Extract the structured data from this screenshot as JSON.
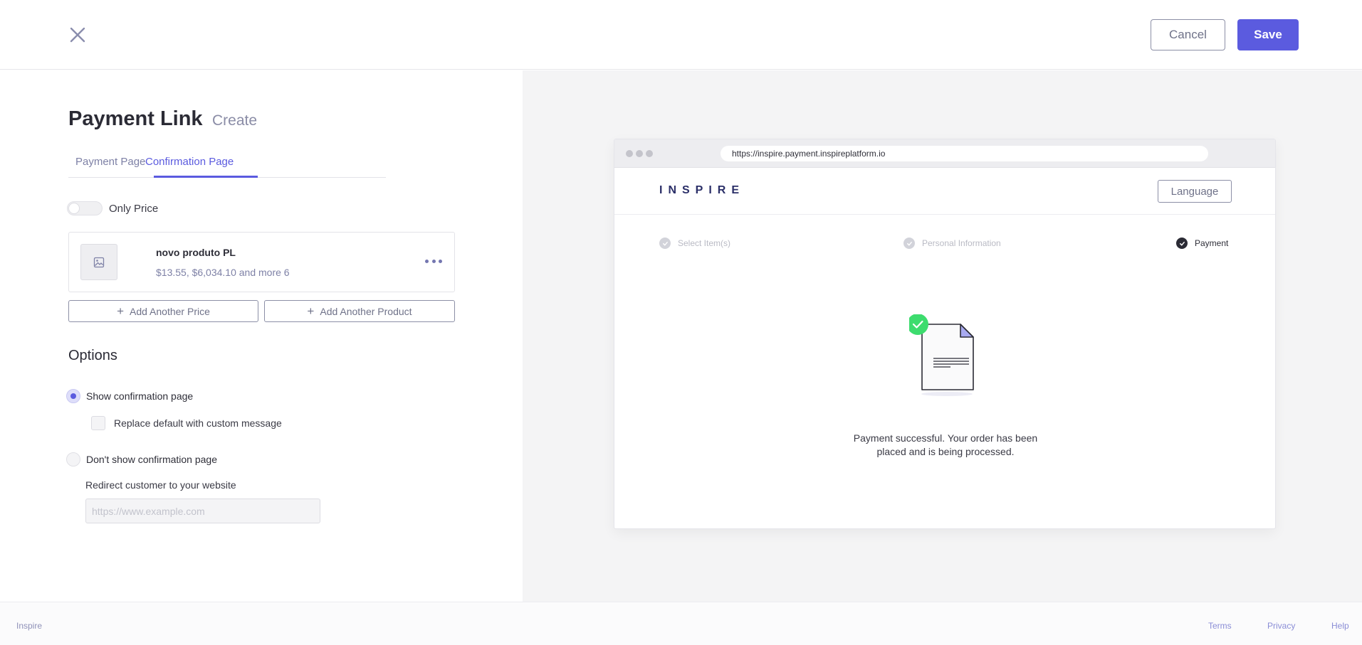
{
  "header": {
    "cancel_label": "Cancel",
    "save_label": "Save"
  },
  "page": {
    "title": "Payment Link",
    "subtitle": "Create"
  },
  "tabs": [
    {
      "label": "Payment Page",
      "active": false
    },
    {
      "label": "Confirmation Page",
      "active": true
    }
  ],
  "only_price": {
    "label": "Only Price",
    "enabled": false
  },
  "product": {
    "name": "novo produto PL",
    "prices": "$13.55, $6,034.10 and more 6"
  },
  "buttons": {
    "add_price": "Add Another Price",
    "add_product": "Add Another Product"
  },
  "options": {
    "title": "Options",
    "show_confirmation": "Show confirmation page",
    "replace_default": "Replace default with custom message",
    "dont_show": "Don't show confirmation page",
    "redirect_label": "Redirect customer to your website",
    "redirect_placeholder": "https://www.example.com",
    "selected": "show_confirmation"
  },
  "preview": {
    "url": "https://inspire.payment.inspireplatform.io",
    "brand": "INSPIRE",
    "language_label": "Language",
    "steps": [
      {
        "label": "Select Item(s)",
        "state": "done"
      },
      {
        "label": "Personal Information",
        "state": "done"
      },
      {
        "label": "Payment",
        "state": "current"
      }
    ],
    "success_message": "Payment successful. Your order has been placed and is being processed."
  },
  "footer": {
    "brand": "Inspire",
    "terms": "Terms",
    "privacy": "Privacy",
    "help": "Help"
  },
  "colors": {
    "accent": "#5b5bdf",
    "success": "#3ddc6e",
    "muted_text": "#7e81a6"
  }
}
